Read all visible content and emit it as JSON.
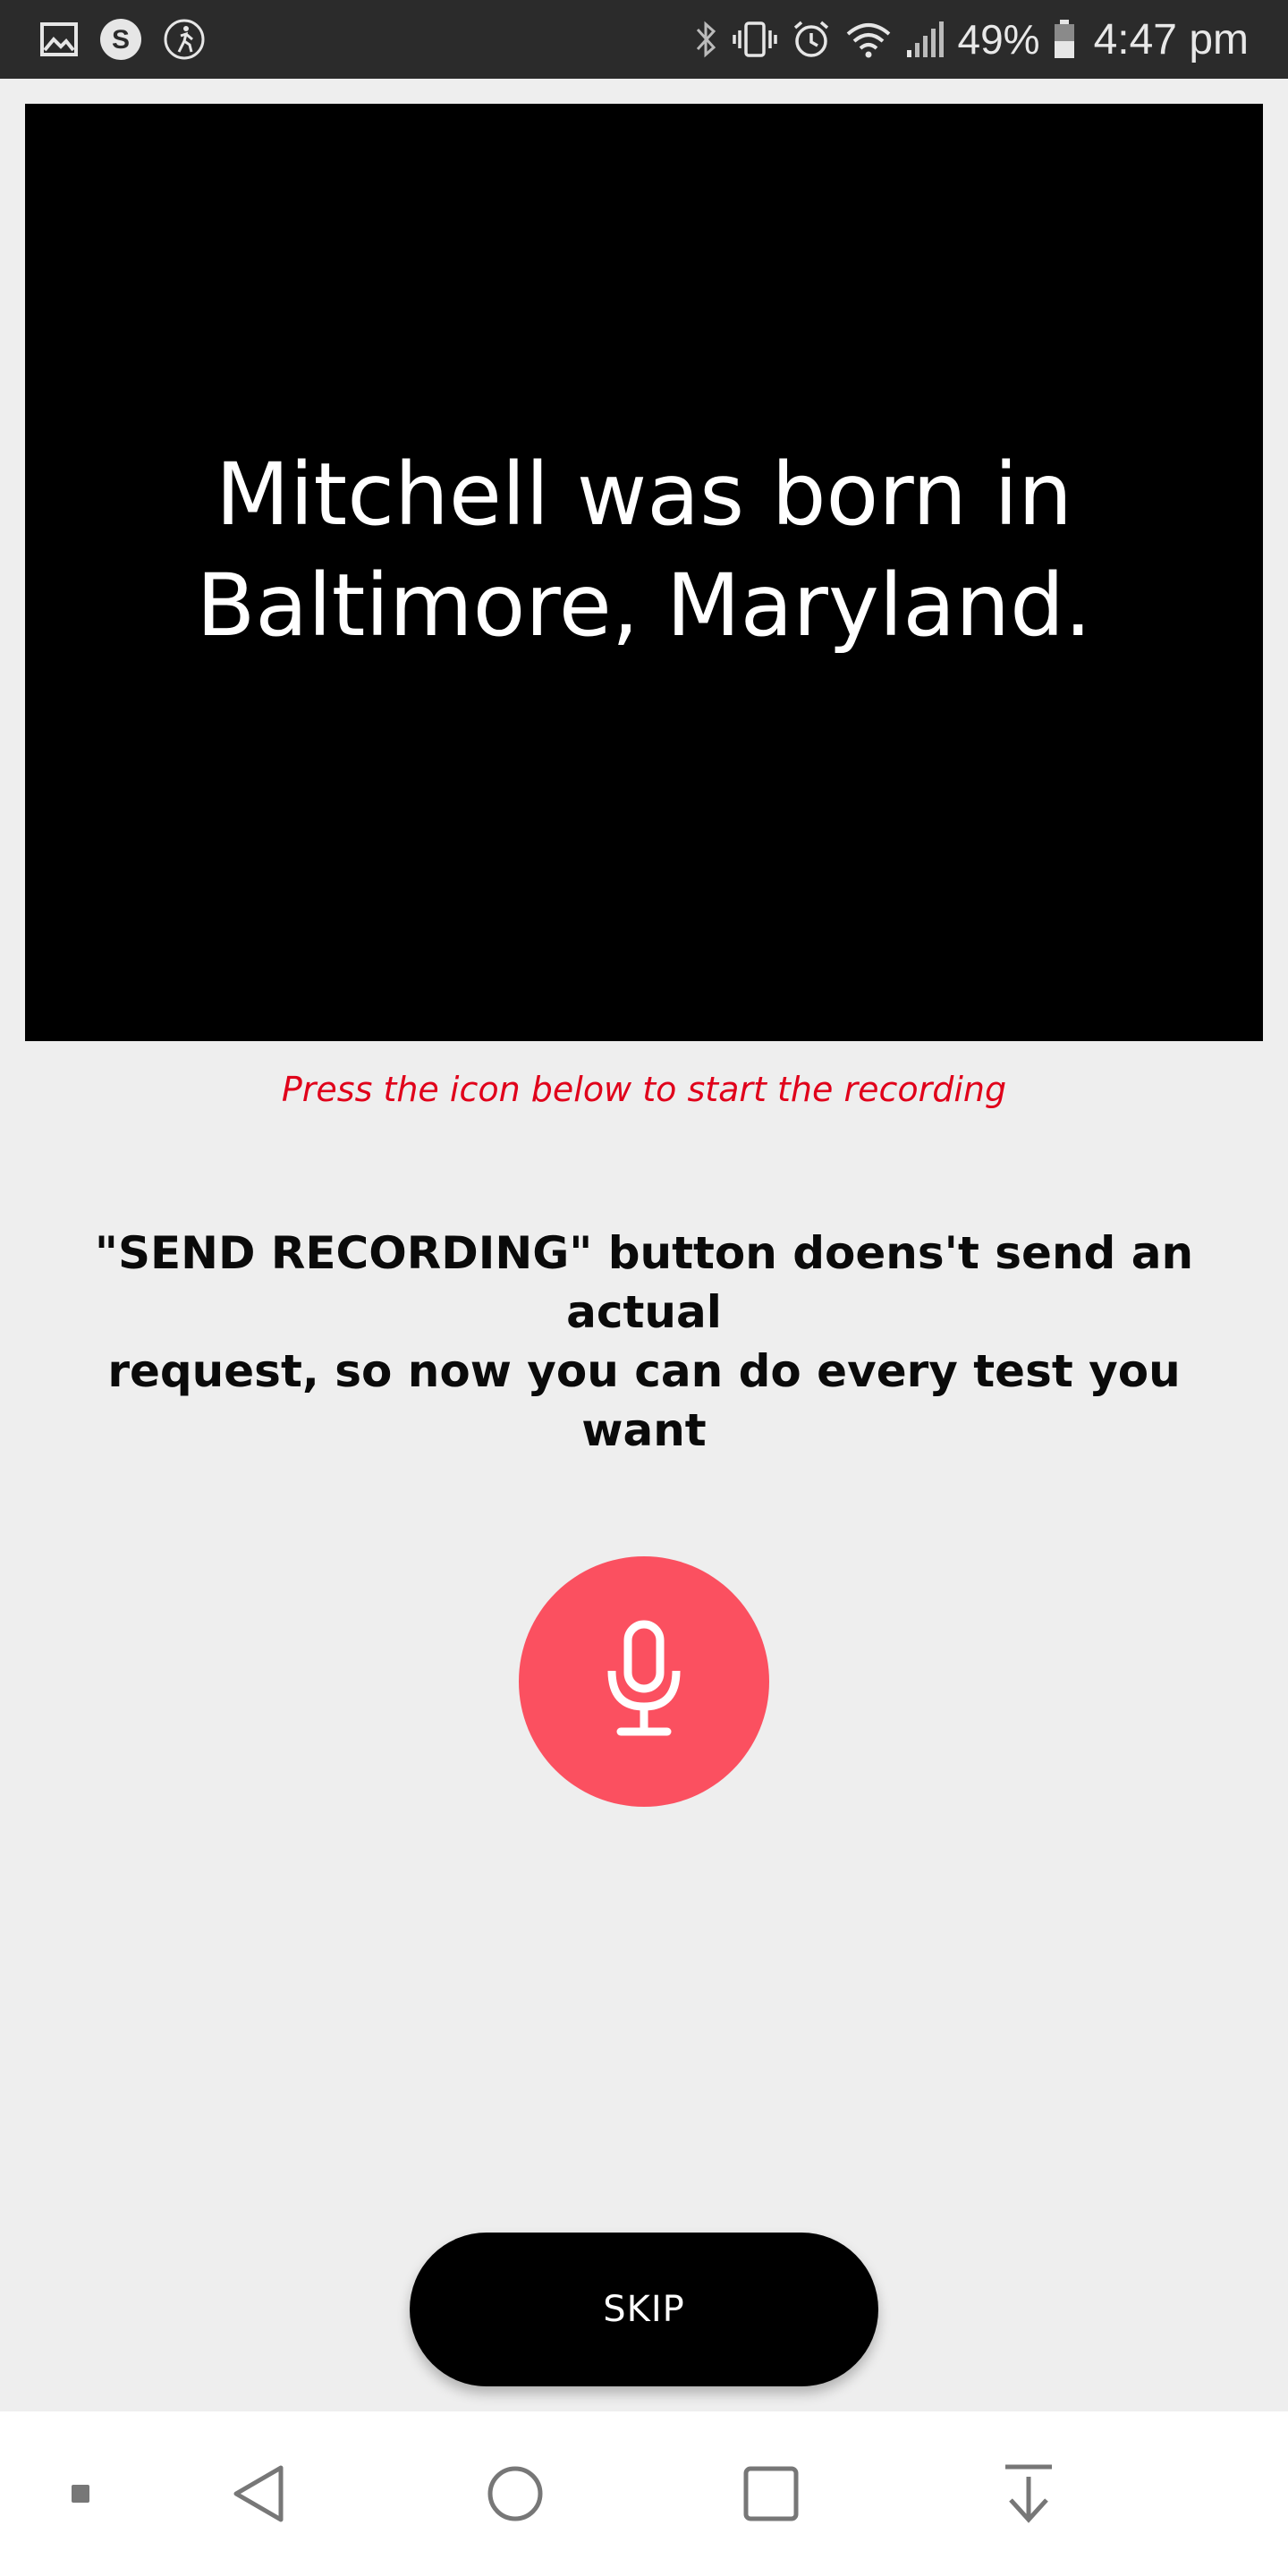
{
  "status_bar": {
    "left_icons": [
      "image-icon",
      "s-app-icon",
      "accessibility-icon"
    ],
    "right_icons": [
      "bluetooth-icon",
      "vibrate-icon",
      "alarm-icon",
      "wifi-icon",
      "signal-icon"
    ],
    "battery": "49%",
    "time": "4:47 pm"
  },
  "prompt": {
    "text": "Mitchell was born in\nBaltimore, Maryland."
  },
  "hint": "Press the icon below to start the recording",
  "notice": "\"SEND RECORDING\" button doens't send an actual\nrequest, so now you can do every test you want",
  "mic_button": {
    "icon": "microphone-icon",
    "color": "#fb5060"
  },
  "skip_button": {
    "label": "SKIP"
  },
  "nav_bar": {
    "items": [
      "dot-icon",
      "back-icon",
      "home-icon",
      "recents-icon",
      "pull-down-icon"
    ]
  }
}
